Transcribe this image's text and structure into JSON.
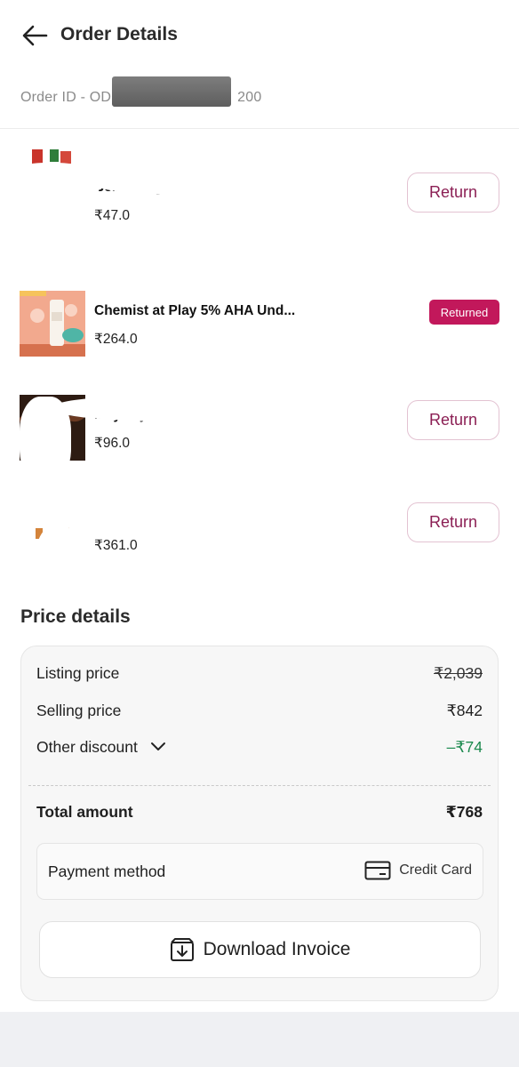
{
  "header": {
    "title": "Order Details"
  },
  "order": {
    "id_text": "Order ID - OD",
    "id_suffix": "200"
  },
  "items": [
    {
      "name": "Bell Energy …",
      "price": "₹47.0",
      "action": "Return"
    },
    {
      "name": "Chemist at Play 5% AHA Und...",
      "price": "₹264.0",
      "status": "Returned"
    },
    {
      "name": "Mayfury Bourn…",
      "price": "₹96.0",
      "action": "Return"
    },
    {
      "name": "…",
      "price": "₹361.0",
      "action": "Return"
    }
  ],
  "price_details": {
    "title": "Price details",
    "listing_label": "Listing price",
    "listing_value": "₹2,039",
    "selling_label": "Selling price",
    "selling_value": "₹842",
    "discount_label": "Other discount",
    "discount_value": "–₹74",
    "total_label": "Total amount",
    "total_value": "₹768"
  },
  "payment": {
    "label": "Payment method",
    "method": "Credit Card"
  },
  "invoice": {
    "label": "Download Invoice"
  },
  "colors": {
    "accent": "#c2185b",
    "return_text": "#8b1f54",
    "discount": "#1c8a4e"
  }
}
